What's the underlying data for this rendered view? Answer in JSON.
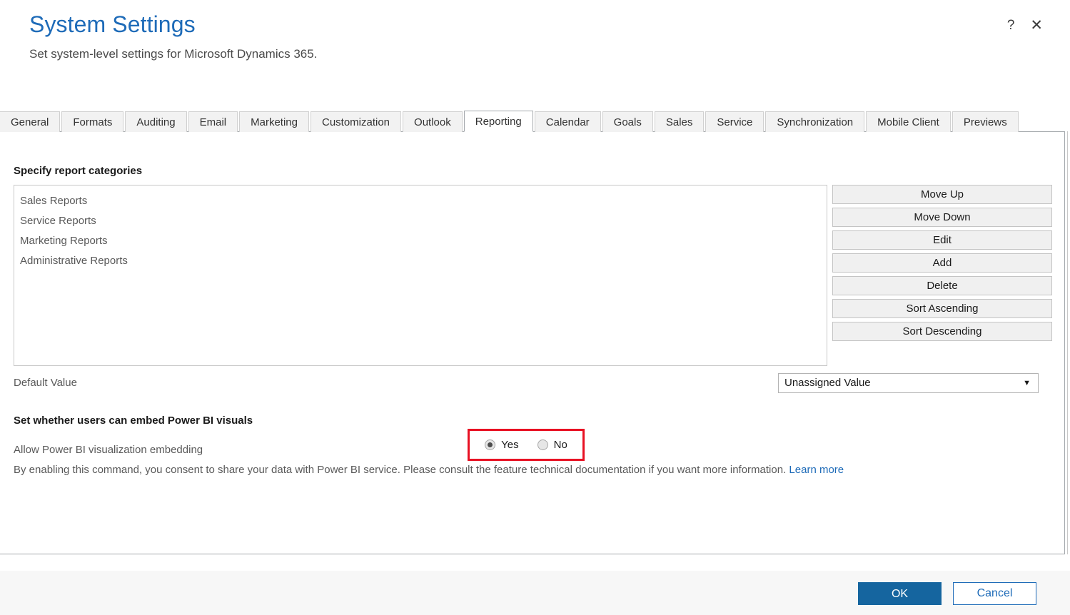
{
  "header": {
    "title": "System Settings",
    "subtitle": "Set system-level settings for Microsoft Dynamics 365.",
    "help_icon": "question-mark-icon",
    "help_glyph": "?",
    "close_icon": "close-icon",
    "close_glyph": "✕"
  },
  "tabs": [
    {
      "label": "General",
      "active": false
    },
    {
      "label": "Formats",
      "active": false
    },
    {
      "label": "Auditing",
      "active": false
    },
    {
      "label": "Email",
      "active": false
    },
    {
      "label": "Marketing",
      "active": false
    },
    {
      "label": "Customization",
      "active": false
    },
    {
      "label": "Outlook",
      "active": false
    },
    {
      "label": "Reporting",
      "active": true
    },
    {
      "label": "Calendar",
      "active": false
    },
    {
      "label": "Goals",
      "active": false
    },
    {
      "label": "Sales",
      "active": false
    },
    {
      "label": "Service",
      "active": false
    },
    {
      "label": "Synchronization",
      "active": false
    },
    {
      "label": "Mobile Client",
      "active": false
    },
    {
      "label": "Previews",
      "active": false
    }
  ],
  "report_categories": {
    "heading": "Specify report categories",
    "items": [
      "Sales Reports",
      "Service Reports",
      "Marketing Reports",
      "Administrative Reports"
    ],
    "buttons": [
      "Move Up",
      "Move Down",
      "Edit",
      "Add",
      "Delete",
      "Sort Ascending",
      "Sort Descending"
    ],
    "default_value": {
      "label": "Default Value",
      "selected": "Unassigned Value",
      "arrow_glyph": "▼"
    }
  },
  "power_bi": {
    "heading": "Set whether users can embed Power BI visuals",
    "setting_label": "Allow Power BI visualization embedding",
    "options": [
      {
        "label": "Yes",
        "checked": true
      },
      {
        "label": "No",
        "checked": false
      }
    ],
    "consent_text": "By enabling this command, you consent to share your data with Power BI service. Please consult the feature technical documentation if you want more information.",
    "link_text": "Learn more",
    "highlight_color": "#e81123"
  },
  "footer": {
    "ok_label": "OK",
    "cancel_label": "Cancel"
  },
  "colors": {
    "title_blue": "#1e6bb8",
    "primary_button": "#15659f",
    "link_blue": "#1e6bb8",
    "highlight_red": "#e81123"
  }
}
